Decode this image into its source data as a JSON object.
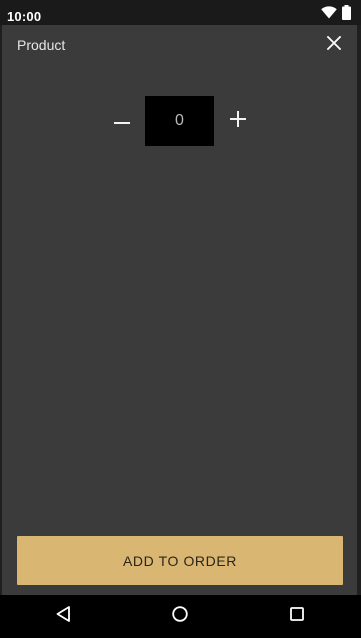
{
  "status_bar": {
    "time": "10:00",
    "icons": [
      "wifi-icon",
      "battery-icon"
    ]
  },
  "dialog": {
    "title": "Product",
    "close_icon": "close-icon"
  },
  "stepper": {
    "value": "0",
    "minus_icon": "minus-icon",
    "plus_icon": "plus-icon"
  },
  "actions": {
    "add_to_order_label": "ADD TO ORDER"
  },
  "navigation": {
    "icons": [
      "back-icon",
      "home-icon",
      "recents-icon"
    ]
  },
  "colors": {
    "dialog_background": "#3b3b3b",
    "accent": "#d9b772",
    "input_background": "#000000",
    "status_bar": "#1a1a1a",
    "nav_bar": "#000000"
  }
}
